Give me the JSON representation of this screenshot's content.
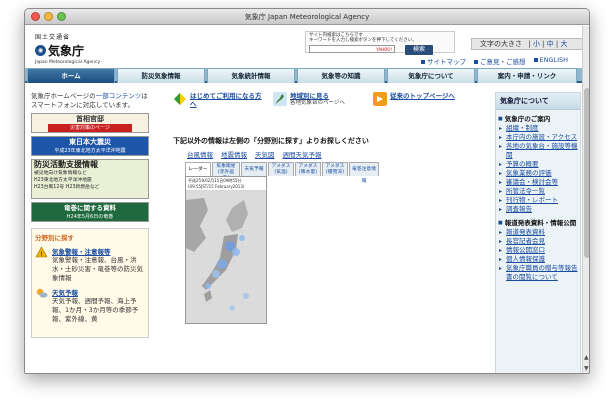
{
  "window": {
    "title": "気象庁 Japan Meteorological Agency"
  },
  "header": {
    "ministry": "国土交通省",
    "agency": "気象庁",
    "agency_en": "Japan Meteorological Agency",
    "search_hint": "サイト内検索はこちらです\nキーワードを入力し検索ボタンを押下してください。",
    "search_placeholder": "YAHOO!",
    "search_button": "検索",
    "fontsize_label": "文字の大きさ",
    "fontsize_small": "小",
    "fontsize_medium": "中",
    "fontsize_large": "大",
    "links": [
      "サイトマップ",
      "ご意見・ご感想",
      "ENGLISH"
    ]
  },
  "nav": {
    "tabs": [
      "ホーム",
      "防災気象情報",
      "気象統計情報",
      "気象等の知識",
      "気象庁について",
      "案内・申請・リンク"
    ]
  },
  "left": {
    "intro_pre": "気象庁ホームページの",
    "intro_link": "一部コンテンツ",
    "intro_post": "はスマートフォンに対応しています。",
    "banner1_title": "首相官邸",
    "banner1_sub": "災害対策のページ",
    "banner2_title": "東日本大震災",
    "banner2_sub": "平成23年東北地方太平洋沖地震",
    "banner3_title": "防災活動支援情報",
    "banner3_l1": "被災地向け気象情報など",
    "banner3_l2": "H23東北地方太平洋沖地震",
    "banner3_l3": "H23台風12号 H23新燃岳など",
    "banner4_title": "竜巻に関する資料",
    "banner4_sub": "H24年5月6日の竜巻",
    "topics_title": "分野別に探す",
    "topics": [
      {
        "head": "気象警報・注意報等",
        "desc": "気象警報・注意報、台風・洪水・土砂災害・竜巻等の防災気象情報"
      },
      {
        "head": "天気予報",
        "desc": "天気予報、週間予報、海上予報、1か月・3か月等の季節予報、紫外線、黄"
      }
    ]
  },
  "center": {
    "guides": [
      {
        "title": "はじめてご利用になる方へ",
        "sub": ""
      },
      {
        "title": "地域別に見る",
        "sub": "各地気象台のページへ"
      },
      {
        "title": "従来のトップページへ",
        "sub": ""
      }
    ],
    "weather_title": "下記以外の情報は左側の「分野別に探す」よりお探しください",
    "weather_links": [
      "台風情報",
      "地震情報",
      "天気図",
      "週間天気予報"
    ],
    "subtabs": [
      "レーダー",
      "気象衛星\n(赤外画像)",
      "天気予報",
      "アメダス\n(気温)",
      "アメダス\n(降水量)",
      "アメダス\n(積雪深)",
      "竜巻注意情報"
    ],
    "map_caption": "平成25年02月15日09時55分 (09:55JST/15 February2013)"
  },
  "right": {
    "title": "気象庁について",
    "groups": [
      {
        "name": "気象庁のご案内",
        "items": [
          "組織・制度",
          "本庁内の施設・アクセス",
          "各地の気象台・施設等機関",
          "予算の概要",
          "気象業務の評価",
          "審議会・検討会等",
          "所管法令一覧",
          "刊行物・レポート",
          "調査報告"
        ]
      },
      {
        "name": "報道発表資料・情報公開",
        "items": [
          "報道発表資料",
          "長官記者会見",
          "情報公開窓口",
          "個人情報保護",
          "気象庁職員の贈与等報告書の閲覧について"
        ]
      }
    ]
  },
  "colors": {
    "nav_bar": "#8fb8cf",
    "nav_active": "#1d4f7f",
    "link": "#1a4da0",
    "accent_orange": "#d2691e"
  }
}
